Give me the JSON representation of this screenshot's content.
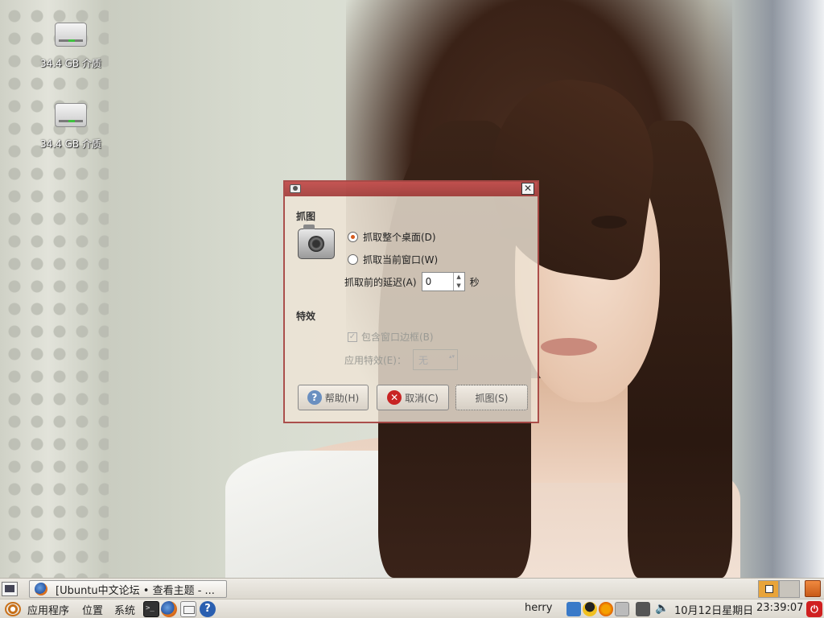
{
  "desktop": {
    "icons": [
      {
        "label": "34.4 GB 介质",
        "icon": "drive-icon"
      },
      {
        "label": "34.4 GB 介质",
        "icon": "drive-icon"
      }
    ]
  },
  "dialog": {
    "close_glyph": "✕",
    "section_capture": "抓图",
    "option_desktop": "抓取整个桌面(D)",
    "option_window": "抓取当前窗口(W)",
    "delay_label": "抓取前的延迟(A)",
    "delay_value": "0",
    "delay_unit": "秒",
    "section_effects": "特效",
    "include_border": "包含窗口边框(B)",
    "apply_effect_label": "应用特效(E)：",
    "effect_value": "无",
    "btn_help": "帮助(H)",
    "btn_cancel": "取消(C)",
    "btn_capture": "抓图(S)"
  },
  "top_panel": {
    "task_title": "[Ubuntu中文论坛 • 查看主题 - ..."
  },
  "bottom_panel": {
    "menu_apps": "应用程序",
    "menu_places": "位置",
    "menu_system": "系统",
    "username": "herry",
    "date": "10月12日星期日",
    "time": "23:39:07",
    "help_glyph": "?",
    "volume_glyph": "🔈",
    "power_glyph": "⏻"
  },
  "colors": {
    "dialog_title": "#a02a2a",
    "radio_accent": "#d65a1e",
    "workspace_active": "#e8a43a"
  }
}
